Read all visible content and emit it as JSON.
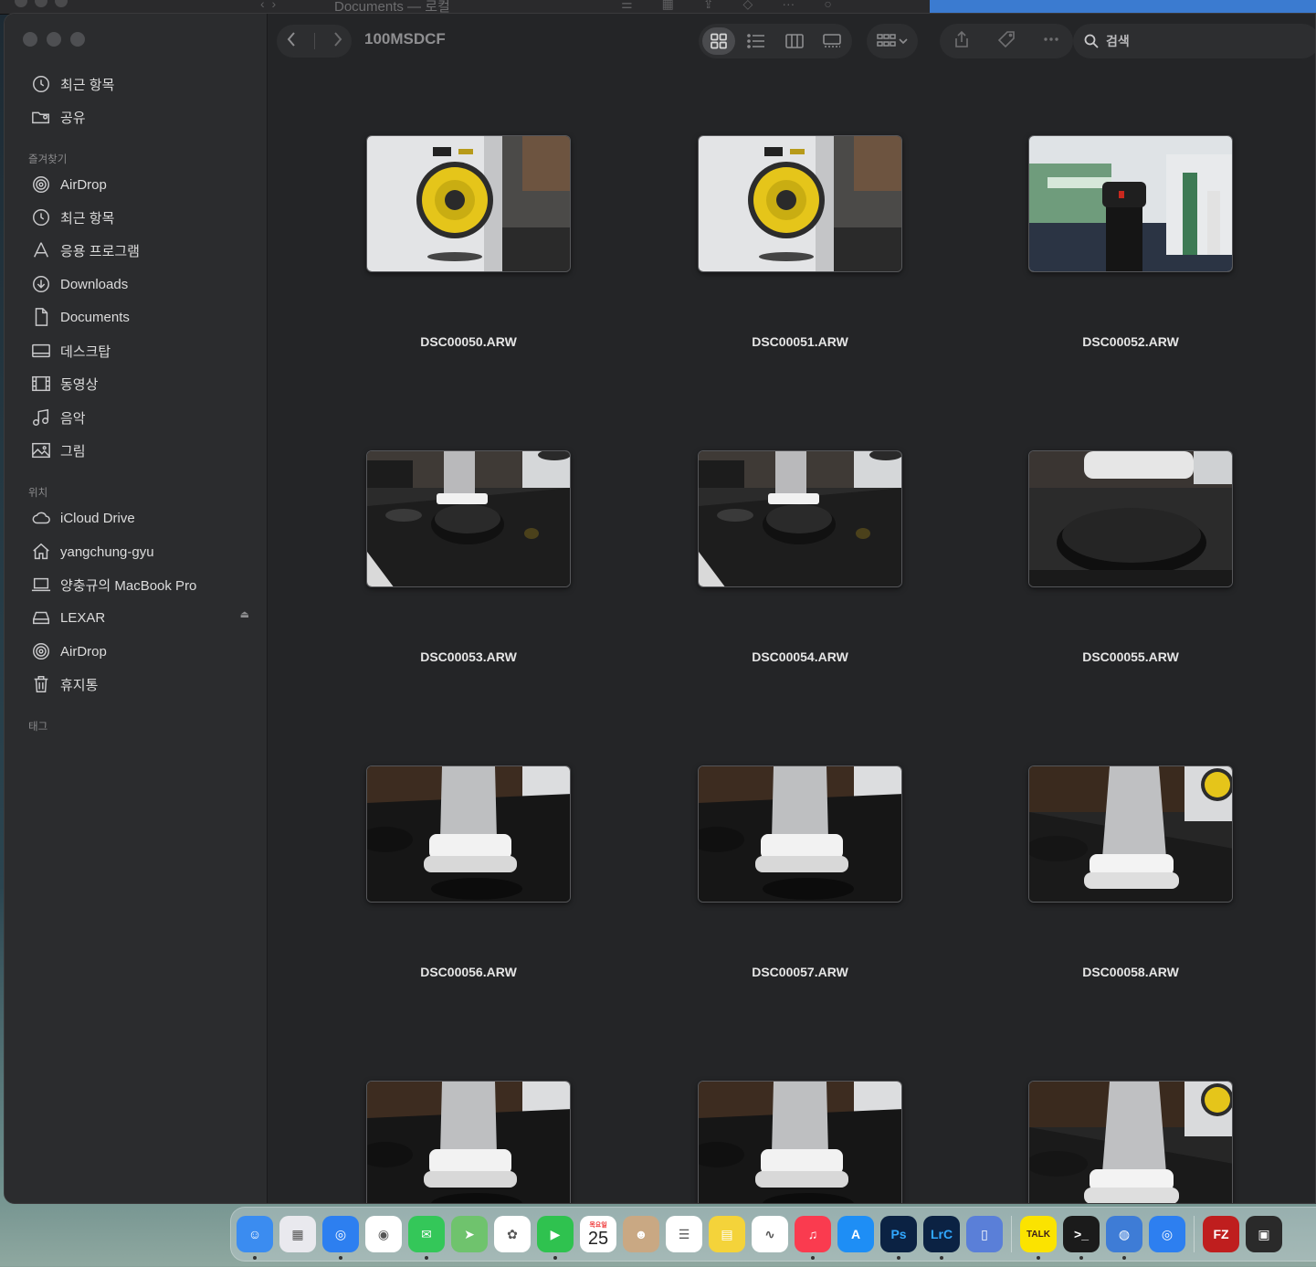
{
  "background_window": {
    "title": "Documents — 로컬"
  },
  "window": {
    "folder_title": "100MSDCF",
    "search_placeholder": "검색"
  },
  "sidebar": {
    "top_items": [
      {
        "label": "최근 항목",
        "icon": "clock-icon"
      },
      {
        "label": "공유",
        "icon": "shared-folder-icon"
      }
    ],
    "favorites_label": "즐겨찾기",
    "favorites": [
      {
        "label": "AirDrop",
        "icon": "airdrop-icon"
      },
      {
        "label": "최근 항목",
        "icon": "clock-icon"
      },
      {
        "label": "응용 프로그램",
        "icon": "applications-icon"
      },
      {
        "label": "Downloads",
        "icon": "download-icon"
      },
      {
        "label": "Documents",
        "icon": "document-icon"
      },
      {
        "label": "데스크탑",
        "icon": "desktop-icon"
      },
      {
        "label": "동영상",
        "icon": "film-icon"
      },
      {
        "label": "음악",
        "icon": "music-icon"
      },
      {
        "label": "그림",
        "icon": "picture-icon"
      }
    ],
    "locations_label": "위치",
    "locations": [
      {
        "label": "iCloud Drive",
        "icon": "cloud-icon"
      },
      {
        "label": "yangchung-gyu",
        "icon": "home-icon"
      },
      {
        "label": "양충규의 MacBook Pro",
        "icon": "laptop-icon"
      },
      {
        "label": "LEXAR",
        "icon": "drive-icon"
      },
      {
        "label": "AirDrop",
        "icon": "airdrop-icon"
      },
      {
        "label": "휴지통",
        "icon": "trash-icon"
      }
    ],
    "tags_label": "태그"
  },
  "files": [
    {
      "name": "DSC00050.ARW",
      "scene": "speaker"
    },
    {
      "name": "DSC00051.ARW",
      "scene": "speaker"
    },
    {
      "name": "DSC00052.ARW",
      "scene": "bottle"
    },
    {
      "name": "DSC00053.ARW",
      "scene": "stand-wide"
    },
    {
      "name": "DSC00054.ARW",
      "scene": "stand-wide"
    },
    {
      "name": "DSC00055.ARW",
      "scene": "disc"
    },
    {
      "name": "DSC00056.ARW",
      "scene": "stand"
    },
    {
      "name": "DSC00057.ARW",
      "scene": "stand"
    },
    {
      "name": "DSC00058.ARW",
      "scene": "stand-angle"
    },
    {
      "name": "",
      "scene": "stand"
    },
    {
      "name": "",
      "scene": "stand"
    },
    {
      "name": "",
      "scene": "stand-angle"
    }
  ],
  "dock": {
    "calendar_day": "25",
    "calendar_weekday": "목요일",
    "apps": [
      {
        "name": "finder",
        "color": "#3b8cf0"
      },
      {
        "name": "launchpad",
        "color": "#e9e9ee"
      },
      {
        "name": "safari",
        "color": "#2d7ff0"
      },
      {
        "name": "chrome",
        "color": "#ffffff"
      },
      {
        "name": "messages",
        "color": "#34c759"
      },
      {
        "name": "maps",
        "color": "#6fc36d"
      },
      {
        "name": "photos",
        "color": "#ffffff"
      },
      {
        "name": "facetime",
        "color": "#2fc24f"
      },
      {
        "name": "calendar",
        "color": "#ffffff"
      },
      {
        "name": "contacts",
        "color": "#c9a883"
      },
      {
        "name": "reminders",
        "color": "#ffffff"
      },
      {
        "name": "notes",
        "color": "#f4d33a"
      },
      {
        "name": "freeform",
        "color": "#ffffff"
      },
      {
        "name": "music",
        "color": "#fa3b4f"
      },
      {
        "name": "app-store",
        "color": "#1e8ef5"
      },
      {
        "name": "photoshop",
        "color": "#0b2243",
        "label": "Ps"
      },
      {
        "name": "lightroom-classic",
        "color": "#0b2243",
        "label": "LrC"
      },
      {
        "name": "simulator",
        "color": "#5a7fd8"
      },
      {
        "name": "kakaotalk",
        "color": "#fbe300",
        "label": "TALK"
      },
      {
        "name": "terminal",
        "color": "#1b1b1b",
        "label": ">_"
      },
      {
        "name": "disk-utility",
        "color": "#3e7cd6"
      },
      {
        "name": "safari-2",
        "color": "#2d7ff0"
      },
      {
        "name": "filezilla",
        "color": "#bf1e1e",
        "label": "FZ"
      },
      {
        "name": "screen-window",
        "color": "#2a2a2a"
      }
    ]
  }
}
